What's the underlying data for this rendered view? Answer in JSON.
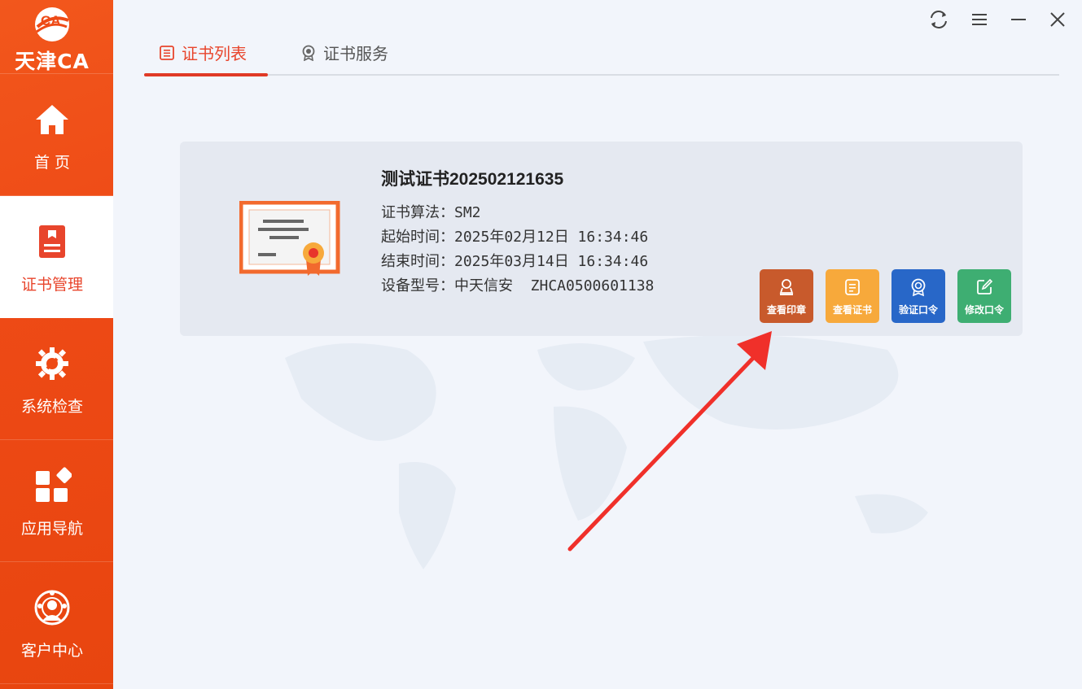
{
  "app": {
    "logo_text": "天津CA",
    "accent": "#ee4a16"
  },
  "sidebar": {
    "items": [
      {
        "label": "首 页",
        "icon": "home-icon",
        "active": false
      },
      {
        "label": "证书管理",
        "icon": "certificate-book-icon",
        "active": true
      },
      {
        "label": "系统检查",
        "icon": "gear-wrench-icon",
        "active": false
      },
      {
        "label": "应用导航",
        "icon": "apps-grid-icon",
        "active": false
      },
      {
        "label": "客户中心",
        "icon": "customer-globe-icon",
        "active": false
      }
    ]
  },
  "window_controls": [
    "refresh-icon",
    "menu-icon",
    "minimize-icon",
    "close-icon"
  ],
  "tabs": [
    {
      "label": "证书列表",
      "icon": "list-icon",
      "active": true
    },
    {
      "label": "证书服务",
      "icon": "badge-icon",
      "active": false
    }
  ],
  "certificate": {
    "title": "测试证书202502121635",
    "algorithm_label": "证书算法：",
    "algorithm_value": "SM2",
    "start_label": "起始时间：",
    "start_value": "2025年02月12日 16:34:46",
    "end_label": "结束时间：",
    "end_value": "2025年03月14日 16:34:46",
    "device_label": "设备型号：",
    "device_value": "中天信安  ZHCA0500601138"
  },
  "actions": [
    {
      "label": "查看印章",
      "icon": "seal-person-icon",
      "color": "#c85a2c"
    },
    {
      "label": "查看证书",
      "icon": "document-icon",
      "color": "#f7a93b"
    },
    {
      "label": "验证口令",
      "icon": "verify-badge-icon",
      "color": "#2867c8"
    },
    {
      "label": "修改口令",
      "icon": "edit-icon",
      "color": "#3eae72"
    }
  ],
  "annotation": {
    "arrow_color": "#f0302a"
  }
}
